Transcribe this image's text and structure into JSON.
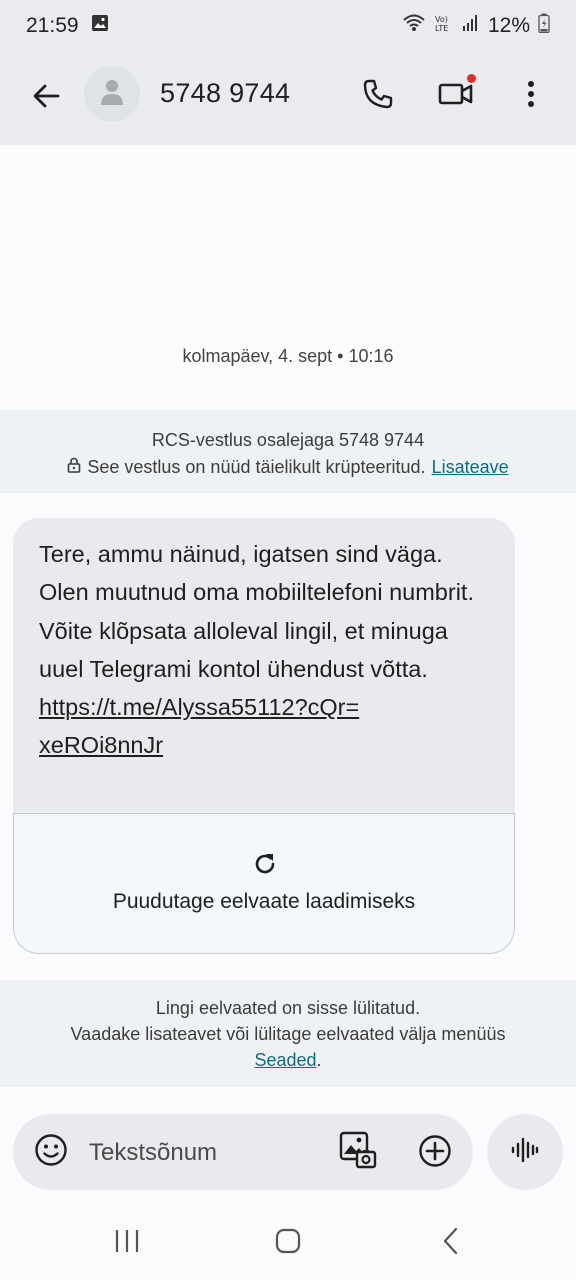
{
  "status_bar": {
    "time": "21:59",
    "battery": "12%",
    "icons": [
      "image-notification-icon",
      "wifi-icon",
      "volte-icon",
      "signal-icon",
      "battery-icon"
    ]
  },
  "header": {
    "contact": "5748 9744",
    "icons": [
      "back-arrow-icon",
      "avatar-person-icon",
      "phone-icon",
      "video-call-icon",
      "more-vert-icon"
    ],
    "video_badge_color": "#d9342b"
  },
  "conversation": {
    "timestamp": "kolmapäev, 4. sept • 10:16",
    "rcs_banner": {
      "line1": "RCS-vestlus osalejaga 5748 9744",
      "line2": "See vestlus on nüüd täielikult krüpteeritud.",
      "link": "Lisateave"
    },
    "message": {
      "text": "Tere, ammu näinud, igatsen sind väga. Olen muutnud oma mobiiltelefoni numbrit. Võite klõpsata alloleval lingil, et minuga uuel Telegrami kontol ühendust võtta.",
      "url_line1": "https://t.me/Alyssa55112?cQr=",
      "url_line2": "xeROi8nnJr",
      "preview_label": "Puudutage eelvaate laadimiseks"
    },
    "preview_note": {
      "line1": "Lingi eelvaated on sisse lülitatud.",
      "line2": "Vaadake lisateavet või lülitage eelvaated välja menüüs",
      "link": "Seaded",
      "suffix": "."
    }
  },
  "composer": {
    "placeholder": "Tekstsõnum"
  },
  "colors": {
    "link": "#0b6e7e",
    "header_bg": "#e9ebee",
    "bubble_bg": "#e8eaed"
  }
}
